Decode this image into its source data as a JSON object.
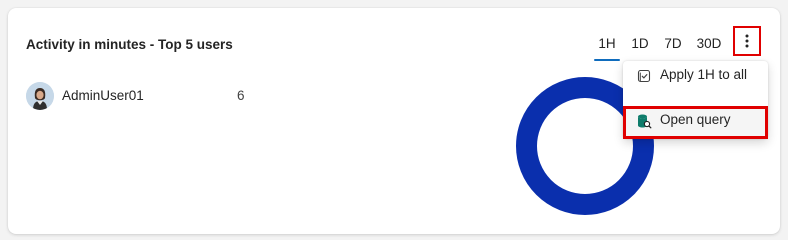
{
  "card": {
    "title": "Activity in minutes - Top 5 users"
  },
  "time_ranges": {
    "tabs": [
      {
        "label": "1H",
        "active": true
      },
      {
        "label": "1D",
        "active": false
      },
      {
        "label": "7D",
        "active": false
      },
      {
        "label": "30D",
        "active": false
      }
    ],
    "more_icon": "more-vertical-icon"
  },
  "users": [
    {
      "name": "AdminUser01",
      "value": "6",
      "avatar_icon": "user-avatar"
    }
  ],
  "chart_data": {
    "type": "pie",
    "style": "donut",
    "categories": [
      "AdminUser01"
    ],
    "values": [
      6
    ],
    "colors": [
      "#0a2fad"
    ]
  },
  "context_menu": {
    "items": [
      {
        "label": "Apply 1H to all",
        "icon": "calendar-check-icon"
      },
      {
        "label": "Open query",
        "icon": "database-search-icon"
      }
    ]
  },
  "colors": {
    "accent": "#0f6cbd",
    "donut": "#0a2fad",
    "highlight_border": "#e00000",
    "query_icon": "#0e7c6b"
  }
}
